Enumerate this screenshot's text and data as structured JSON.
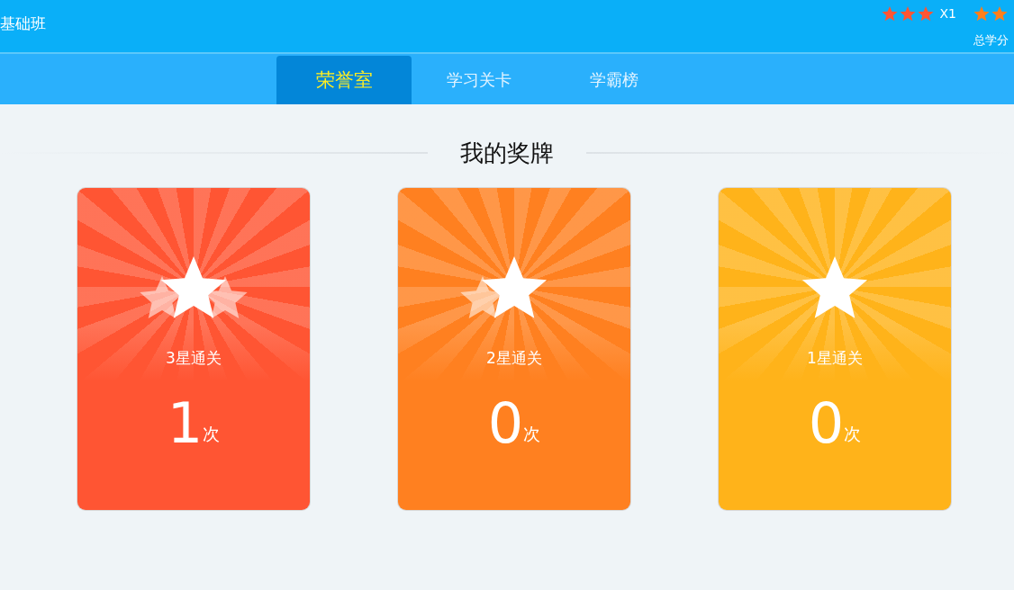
{
  "header": {
    "class_name": "基础班",
    "star_badges": [
      {
        "kind": "three",
        "color": "#ff5533",
        "count": "X1"
      },
      {
        "kind": "two",
        "color": "#ff7f1a"
      }
    ],
    "credits_label": "总学分"
  },
  "tabs": [
    {
      "label": "荣誉室",
      "selected": true
    },
    {
      "label": "学习关卡",
      "selected": false
    },
    {
      "label": "学霸榜",
      "selected": false
    }
  ],
  "section_title": "我的奖牌",
  "medals": [
    {
      "kind": "three",
      "color": "#ff5533",
      "label": "3星通关",
      "count": "1",
      "unit": "次"
    },
    {
      "kind": "two",
      "color": "#ff8020",
      "label": "2星通关",
      "count": "0",
      "unit": "次"
    },
    {
      "kind": "one",
      "color": "#ffb31a",
      "label": "1星通关",
      "count": "0",
      "unit": "次"
    }
  ]
}
